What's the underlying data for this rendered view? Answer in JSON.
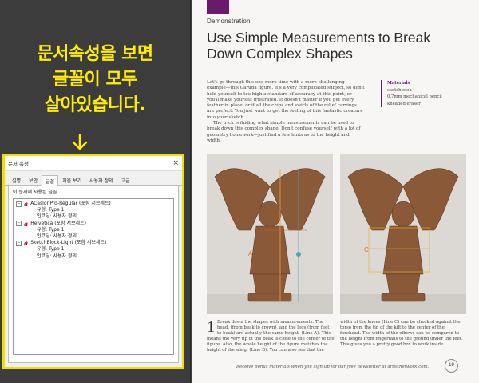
{
  "overlay": {
    "caption_lines": [
      "문서속성을 보면",
      "글꼴이 모두",
      "살아있습니다."
    ],
    "highlight_color": "#ffee00"
  },
  "dialog": {
    "title": "문서 속성",
    "close": "×",
    "tabs": [
      "설명",
      "보안",
      "글꼴",
      "처음 보기",
      "사용자 정의",
      "고급"
    ],
    "active_tab": "글꼴",
    "heading": "이 문서에 사용된 글꼴",
    "fonts": [
      {
        "name": "ACaslonPro-Regular (포함 서브세트)",
        "type": "유형: Type 1",
        "encoding": "인코딩: 사용자 정의"
      },
      {
        "name": "Helvetica (포함 서브세트)",
        "type": "유형: Type 1",
        "encoding": "인코딩: 사용자 정의"
      },
      {
        "name": "SketchBlock-Light (포함 서브세트)",
        "type": "유형: Type 1",
        "encoding": "인코딩: 사용자 정의"
      }
    ],
    "font_icon": "a"
  },
  "book": {
    "section": "Demonstration",
    "title": "Use Simple Measurements to Break Down Complex Shapes",
    "intro": "Let's go through this one more time with a more challenging example—this Garuda figure. It's a very complicated subject, so don't hold yourself to too high a standard of accuracy at this point, or you'll make yourself frustrated. It doesn't matter if you get every feather in place, or if all the chips and swirls of the relief carvings are perfect. You just want to get the feeling of this fantastic creature into your sketch.",
    "intro2": "The trick is finding what simple measurements can be used to break down this complex shape. Don't confuse yourself with a lot of geometry homework—just find a few hints as to the height and width.",
    "materials_heading": "Materials",
    "materials": [
      "sketchbook",
      "0.7mm mechanical pencil",
      "kneaded eraser"
    ],
    "step_number": "1",
    "caption_left": "Break down the shapes with measurements. The head, (from beak to crown), and the legs (from feet to beak) are actually the same height. (Line A). This means the very tip of the beak is close to the center of the figure. Also, the whole height of the figure matches the height of the wing. (Line B). You can also see that the",
    "caption_right": "width of the knees (Line C) can be checked against the torso from the tip of the kilt to the center of the forehead. The width of the elbows can be compared to the height from fingertails to the ground under the feet. This gives you a pretty good box to work inside.",
    "footer": "Receive bonus materials when you sign up for our free newsletter at artistnetwork.com.",
    "page_number": "19",
    "photo_labels": {
      "a": "A",
      "c": "C"
    },
    "accent": "#6a1a6d"
  }
}
